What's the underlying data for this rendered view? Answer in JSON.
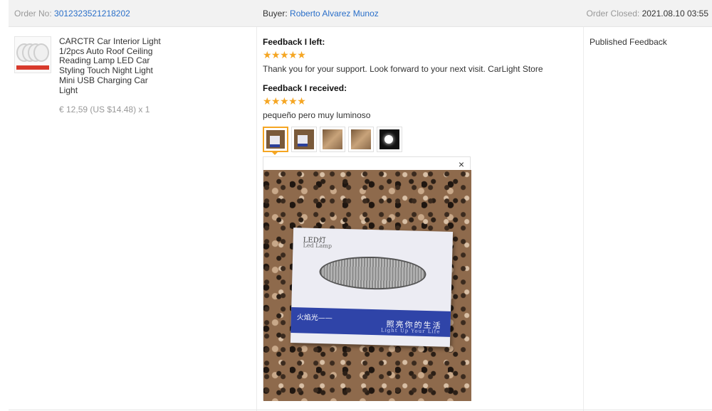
{
  "header": {
    "order_label": "Order No:",
    "order_no": "3012323521218202",
    "buyer_label": "Buyer:",
    "buyer_name": "Roberto Alvarez Munoz",
    "closed_label": "Order Closed:",
    "closed_date": "2021.08.10 03:55"
  },
  "product": {
    "title": "CARCTR Car Interior Light 1/2pcs Auto Roof Ceiling Reading Lamp LED Car Styling Touch Night Light Mini USB Charging Car Light",
    "price": "€ 12,59 (US $14.48) x 1",
    "icon": "product-thumbnail"
  },
  "feedback_left": {
    "title": "Feedback I left:",
    "stars": "★★★★★",
    "rating": 5,
    "text": "Thank you for your support. Look forward to your next visit. CarLight Store"
  },
  "feedback_received": {
    "title": "Feedback I received:",
    "stars": "★★★★★",
    "rating": 5,
    "text": "pequeño pero muy luminoso",
    "photo_count": 5,
    "selected_photo": 1
  },
  "preview": {
    "close_label": "×",
    "pkg_logo": "LED灯",
    "pkg_sub": "Led Lamp",
    "pkg_brand": "火焰光——",
    "pkg_slogan": "照亮你的生活",
    "pkg_slogan_en": "Light Up Your Life"
  },
  "status": {
    "label": "Published Feedback"
  },
  "colors": {
    "link": "#2a6fc9",
    "star": "#f5a623",
    "header_bg": "#f2f2f2"
  }
}
